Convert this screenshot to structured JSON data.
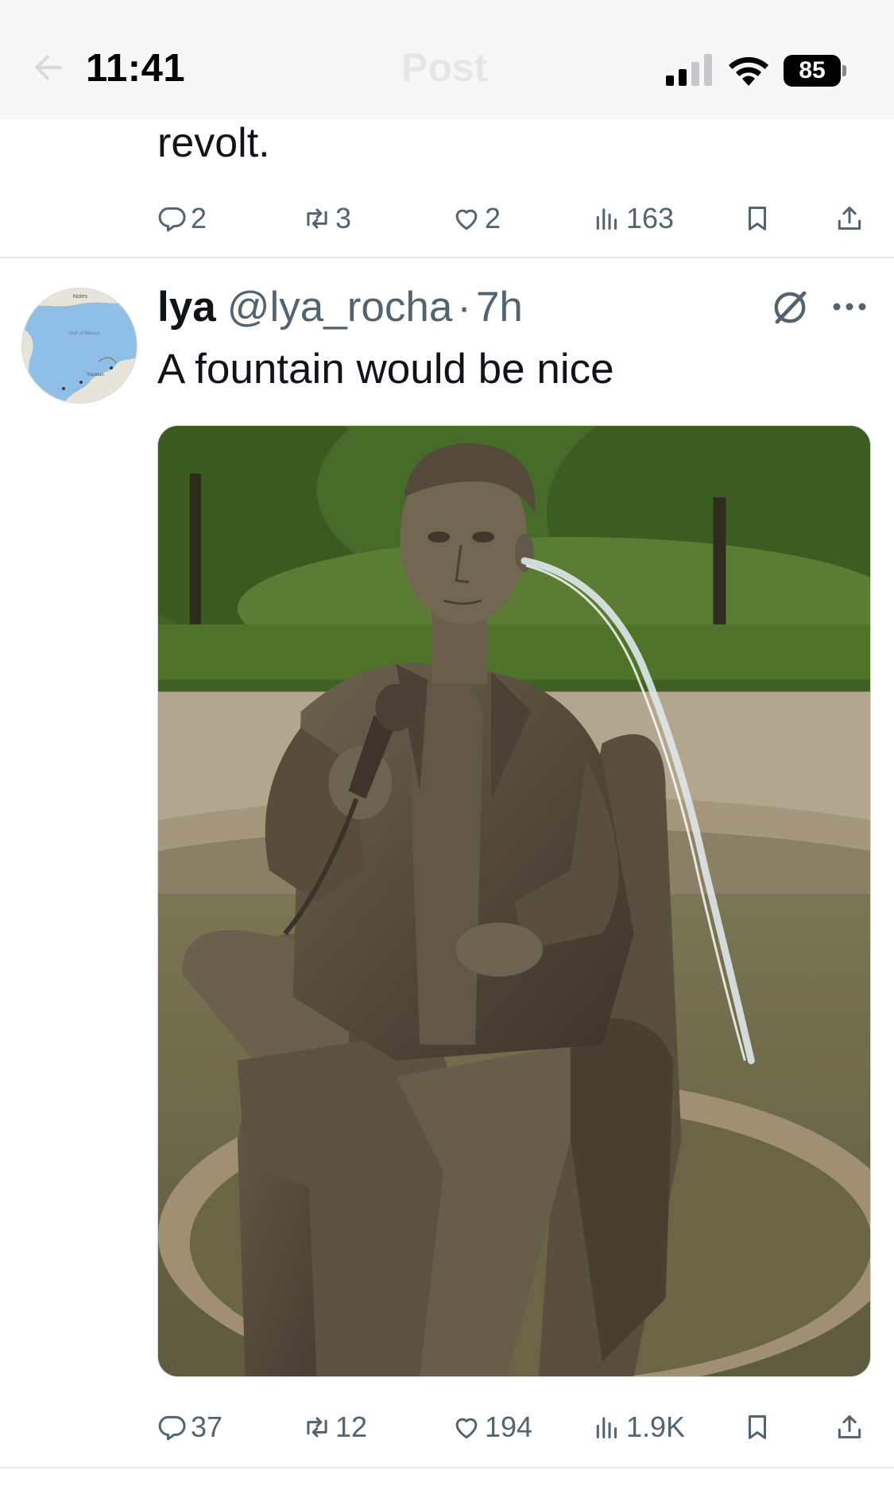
{
  "status_bar": {
    "time": "11:41",
    "battery": "85",
    "header_title": "Post"
  },
  "previous_post": {
    "text_tail": "revolt.",
    "actions": {
      "replies": "2",
      "reposts": "3",
      "likes": "2",
      "views": "163"
    }
  },
  "post": {
    "author_name": "lya",
    "author_handle": "@lya_rocha",
    "separator": "·",
    "time": "7h",
    "text": "A fountain would be nice",
    "avatar_labels": {
      "top": "Notes",
      "middle": "Gulf of Mexico",
      "bottom": "Yucatan"
    },
    "actions": {
      "replies": "37",
      "reposts": "12",
      "likes": "194",
      "views": "1.9K"
    }
  },
  "colors": {
    "text_primary": "#0f1419",
    "text_secondary": "#536471",
    "divider": "#e7e9ea",
    "background": "#ffffff"
  },
  "icons": [
    "back-arrow-icon",
    "signal-icon",
    "wifi-icon",
    "battery-icon",
    "reply-icon",
    "repost-icon",
    "like-icon",
    "views-icon",
    "bookmark-icon",
    "share-icon",
    "grok-icon",
    "more-icon"
  ]
}
